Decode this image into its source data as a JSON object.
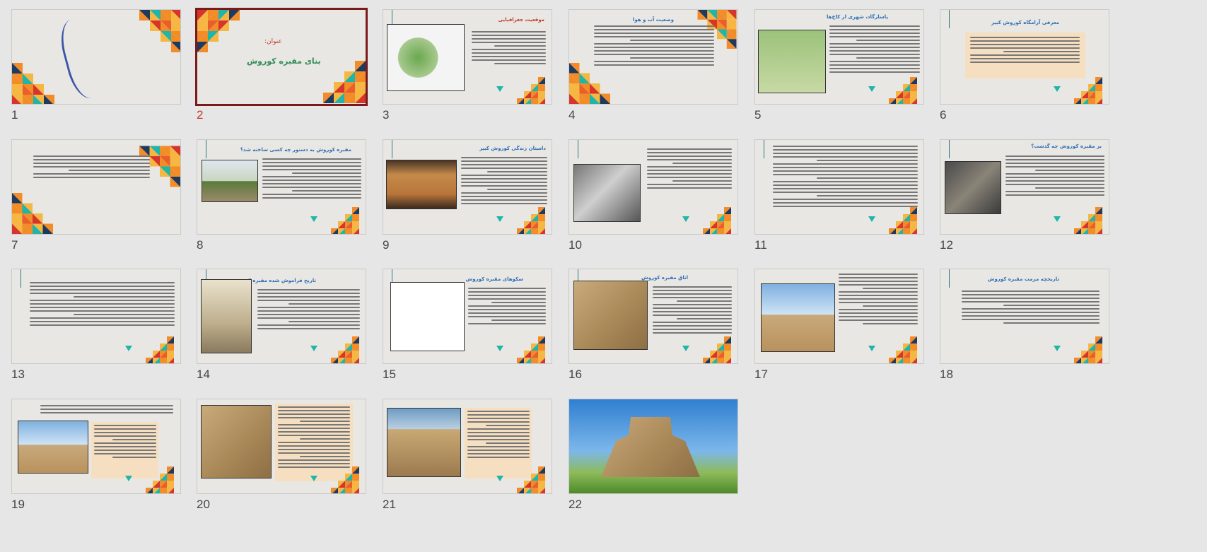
{
  "window": {
    "view": "Slide Sorter"
  },
  "selected_slide": 2,
  "slides": [
    {
      "number": "1",
      "title": "",
      "body": ""
    },
    {
      "number": "2",
      "title": "بنای مقبره کوروش",
      "label": "عنوان:"
    },
    {
      "number": "3",
      "title": "موقعیت جغرافیایی"
    },
    {
      "number": "4",
      "title": "وضعیت آب و هوا"
    },
    {
      "number": "5",
      "title": "پاسارگاد، شهری از کاخ‌ها"
    },
    {
      "number": "6",
      "title": "معرفی آرامگاه کوروش کبیر"
    },
    {
      "number": "7",
      "title": ""
    },
    {
      "number": "8",
      "title": "مقبره کوروش به دستور چه کسی ساخته شد؟"
    },
    {
      "number": "9",
      "title": "داستان زندگی کوروش کبیر"
    },
    {
      "number": "10",
      "title": ""
    },
    {
      "number": "11",
      "title": ""
    },
    {
      "number": "12",
      "title": "بر مقبره کوروش چه گذشت؟"
    },
    {
      "number": "13",
      "title": ""
    },
    {
      "number": "14",
      "title": "تاریخ فراموش شده مقبره کوروش"
    },
    {
      "number": "15",
      "title": "سکوهای مقبره کوروش"
    },
    {
      "number": "16",
      "title": "اتاق مقبره کوروش"
    },
    {
      "number": "17",
      "title": ""
    },
    {
      "number": "18",
      "title": "تاریخچه مرمت مقبره کوروش"
    },
    {
      "number": "19",
      "title": ""
    },
    {
      "number": "20",
      "title": ""
    },
    {
      "number": "21",
      "title": ""
    },
    {
      "number": "22",
      "title": ""
    }
  ],
  "colors": {
    "background": "#e6e6e6",
    "slide_bg": "#e9e7e3",
    "title_blue": "#2e6db4",
    "title_red": "#c0392b",
    "title_green": "#2e8b57",
    "selection_border": "#7a1a1a",
    "accent_teal": "#1fb5a8",
    "accent_orange": "#f28c28",
    "accent_red": "#d7352b",
    "accent_navy": "#1e3a5f",
    "beige_box": "#f6dfc0"
  }
}
